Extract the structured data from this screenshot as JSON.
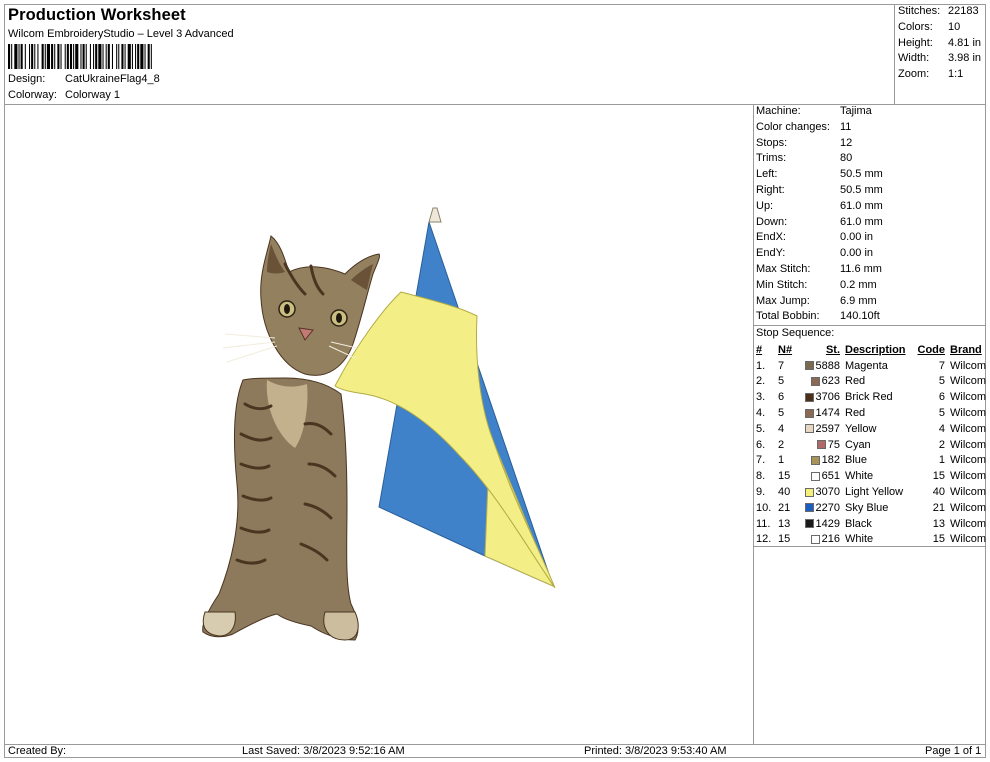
{
  "header": {
    "title": "Production Worksheet",
    "software": "Wilcom EmbroideryStudio – Level 3 Advanced",
    "design_label": "Design:",
    "design_value": "CatUkraineFlag4_8",
    "colorway_label": "Colorway:",
    "colorway_value": "Colorway 1"
  },
  "stats": [
    {
      "label": "Stitches:",
      "value": "22183"
    },
    {
      "label": "Colors:",
      "value": "10"
    },
    {
      "label": "Height:",
      "value": "4.81 in"
    },
    {
      "label": "Width:",
      "value": "3.98 in"
    },
    {
      "label": "Zoom:",
      "value": "1:1"
    }
  ],
  "properties": [
    {
      "label": "Machine:",
      "value": "Tajima"
    },
    {
      "label": "Color changes:",
      "value": "11"
    },
    {
      "label": "Stops:",
      "value": "12"
    },
    {
      "label": "Trims:",
      "value": "80"
    },
    {
      "label": "Left:",
      "value": "50.5 mm"
    },
    {
      "label": "Right:",
      "value": "50.5 mm"
    },
    {
      "label": "Up:",
      "value": "61.0 mm"
    },
    {
      "label": "Down:",
      "value": "61.0 mm"
    },
    {
      "label": "EndX:",
      "value": "0.00 in"
    },
    {
      "label": "EndY:",
      "value": "0.00 in"
    },
    {
      "label": "Max Stitch:",
      "value": "11.6 mm"
    },
    {
      "label": "Min Stitch:",
      "value": "0.2 mm"
    },
    {
      "label": "Max Jump:",
      "value": "6.9 mm"
    },
    {
      "label": "Total Bobbin:",
      "value": "140.10ft"
    }
  ],
  "stop_sequence": {
    "title": "Stop Sequence:",
    "headers": {
      "num": "#",
      "n": "N#",
      "st": "St.",
      "desc": "Description",
      "code": "Code",
      "brand": "Brand"
    },
    "rows": [
      {
        "num": "1.",
        "n": "7",
        "color": "#7a6a52",
        "st": "5888",
        "desc": "Magenta",
        "code": "7",
        "brand": "Wilcom"
      },
      {
        "num": "2.",
        "n": "5",
        "color": "#8a6a55",
        "st": "623",
        "desc": "Red",
        "code": "5",
        "brand": "Wilcom"
      },
      {
        "num": "3.",
        "n": "6",
        "color": "#4a3018",
        "st": "3706",
        "desc": "Brick Red",
        "code": "6",
        "brand": "Wilcom"
      },
      {
        "num": "4.",
        "n": "5",
        "color": "#8a6a55",
        "st": "1474",
        "desc": "Red",
        "code": "5",
        "brand": "Wilcom"
      },
      {
        "num": "5.",
        "n": "4",
        "color": "#e6d6c2",
        "st": "2597",
        "desc": "Yellow",
        "code": "4",
        "brand": "Wilcom"
      },
      {
        "num": "6.",
        "n": "2",
        "color": "#b06868",
        "st": "75",
        "desc": "Cyan",
        "code": "2",
        "brand": "Wilcom"
      },
      {
        "num": "7.",
        "n": "1",
        "color": "#a89458",
        "st": "182",
        "desc": "Blue",
        "code": "1",
        "brand": "Wilcom"
      },
      {
        "num": "8.",
        "n": "15",
        "color": "#ffffff",
        "st": "651",
        "desc": "White",
        "code": "15",
        "brand": "Wilcom"
      },
      {
        "num": "9.",
        "n": "40",
        "color": "#f4f07a",
        "st": "3070",
        "desc": "Light Yellow",
        "code": "40",
        "brand": "Wilcom"
      },
      {
        "num": "10.",
        "n": "21",
        "color": "#1a5fc0",
        "st": "2270",
        "desc": "Sky Blue",
        "code": "21",
        "brand": "Wilcom"
      },
      {
        "num": "11.",
        "n": "13",
        "color": "#1a1a1a",
        "st": "1429",
        "desc": "Black",
        "code": "13",
        "brand": "Wilcom"
      },
      {
        "num": "12.",
        "n": "15",
        "color": "#ffffff",
        "st": "216",
        "desc": "White",
        "code": "15",
        "brand": "Wilcom"
      }
    ]
  },
  "footer": {
    "created_by": "Created By:",
    "last_saved": "Last Saved: 3/8/2023 9:52:16 AM",
    "printed": "Printed: 3/8/2023 9:53:40 AM",
    "page": "Page 1 of 1"
  },
  "design_preview": {
    "icon": "cat-with-ukraine-flag-embroidery",
    "colors": {
      "flag_blue": "#3f82c9",
      "flag_yellow": "#f3ee86",
      "pole": "#ece6d6",
      "cat_fur": "#8d7a5c",
      "cat_stripe": "#4a3520"
    }
  }
}
